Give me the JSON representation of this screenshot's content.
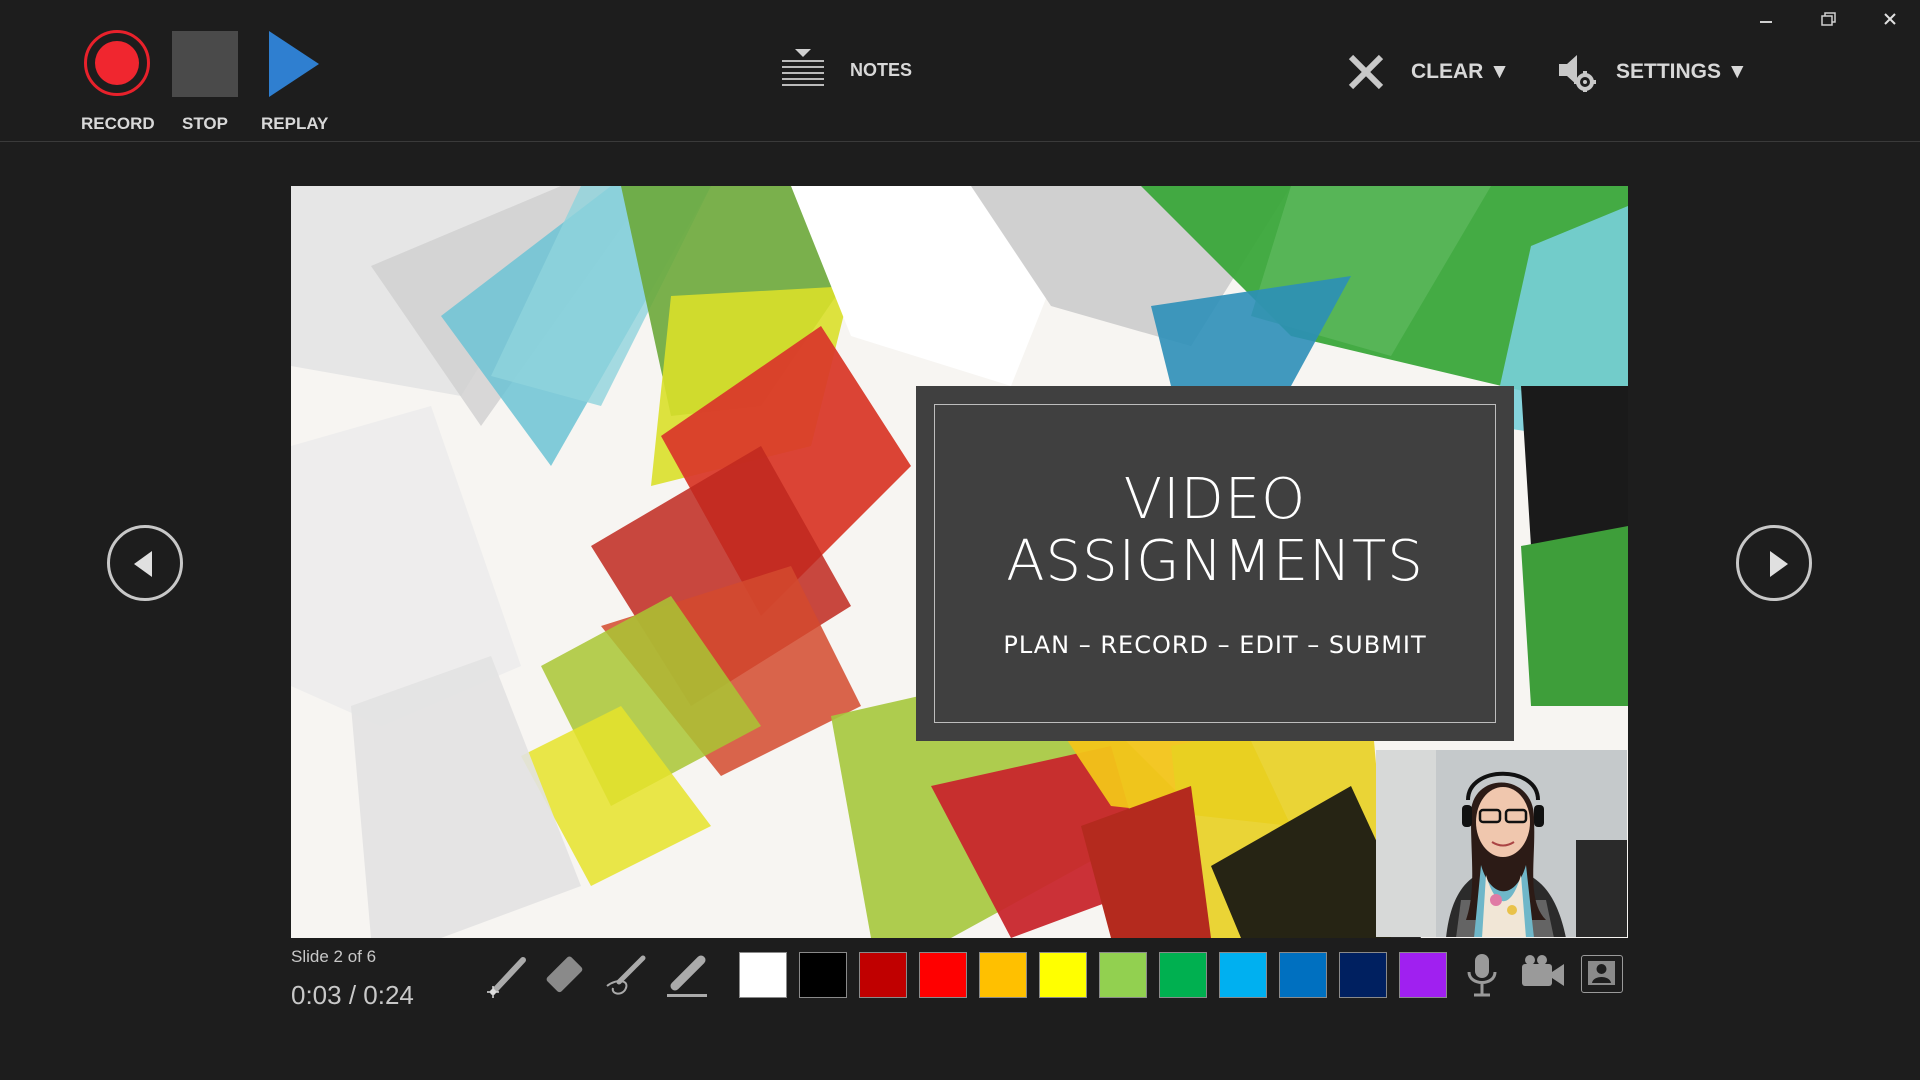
{
  "window": {
    "minimize_icon": "minimize-icon",
    "restore_icon": "restore-icon",
    "close_icon": "close-icon"
  },
  "toolbar": {
    "record_label": "RECORD",
    "stop_label": "STOP",
    "replay_label": "REPLAY",
    "notes_label": "NOTES",
    "clear_label": "CLEAR ▼",
    "settings_label": "SETTINGS ▼"
  },
  "slide": {
    "title_line1": "VIDEO",
    "title_line2": "ASSIGNMENTS",
    "subtitle": "PLAN – RECORD – EDIT – SUBMIT"
  },
  "status": {
    "slide_counter": "Slide 2 of 6",
    "timer": "0:03  /  0:24"
  },
  "pen_tools": [
    "laser-pointer-icon",
    "eraser-icon",
    "pen-icon",
    "highlighter-icon"
  ],
  "ink_colors": [
    {
      "name": "white",
      "hex": "#ffffff"
    },
    {
      "name": "black",
      "hex": "#000000"
    },
    {
      "name": "dark-red",
      "hex": "#c00000"
    },
    {
      "name": "red",
      "hex": "#ff0000"
    },
    {
      "name": "orange",
      "hex": "#ffc000"
    },
    {
      "name": "yellow",
      "hex": "#ffff00"
    },
    {
      "name": "light-green",
      "hex": "#92d050"
    },
    {
      "name": "green",
      "hex": "#00b050"
    },
    {
      "name": "light-blue",
      "hex": "#00b0f0"
    },
    {
      "name": "blue",
      "hex": "#0070c0"
    },
    {
      "name": "dark-blue",
      "hex": "#002060"
    },
    {
      "name": "purple",
      "hex": "#a020f0"
    }
  ],
  "media_controls": [
    "microphone-icon",
    "camera-icon",
    "camera-preview-icon"
  ],
  "colors": {
    "record_red": "#f0262f",
    "replay_blue": "#2f7fd0",
    "background": "#1d1d1d"
  }
}
